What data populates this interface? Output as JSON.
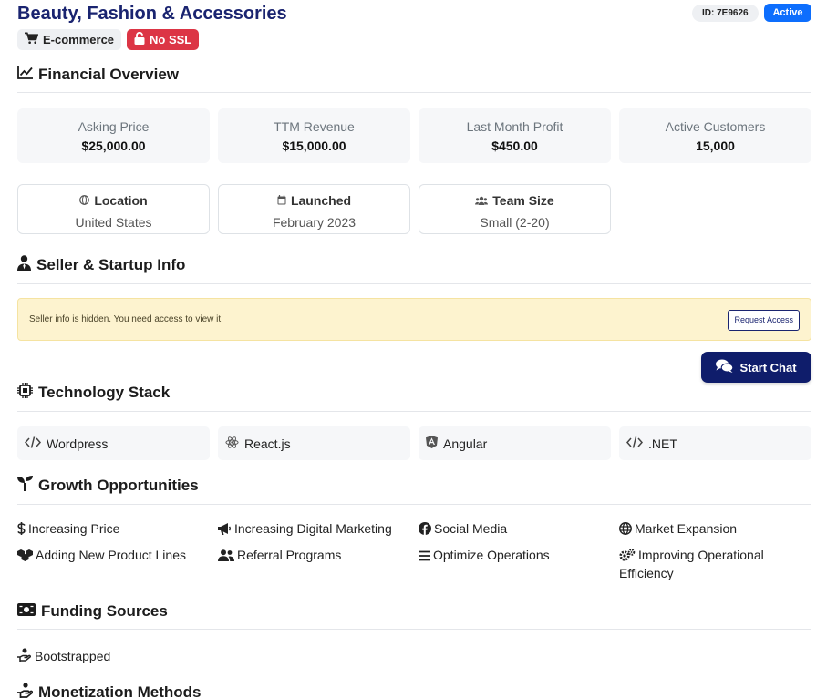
{
  "header": {
    "title": "Beauty, Fashion & Accessories",
    "id_label": "ID: 7E9626",
    "status": "Active",
    "tags": [
      {
        "label": "E-commerce",
        "icon": "cart-icon"
      },
      {
        "label": "No SSL",
        "icon": "unlock-icon",
        "color": "#dc3545"
      }
    ]
  },
  "financial": {
    "heading": "Financial Overview",
    "stats": [
      {
        "label": "Asking Price",
        "value": "$25,000.00"
      },
      {
        "label": "TTM Revenue",
        "value": "$15,000.00"
      },
      {
        "label": "Last Month Profit",
        "value": "$450.00"
      },
      {
        "label": "Active Customers",
        "value": "15,000"
      }
    ],
    "info": [
      {
        "label": "Location",
        "value": "United States",
        "icon": "globe-icon"
      },
      {
        "label": "Launched",
        "value": "February 2023",
        "icon": "calendar-icon"
      },
      {
        "label": "Team Size",
        "value": "Small (2-20)",
        "icon": "users-icon"
      }
    ]
  },
  "seller": {
    "heading": "Seller & Startup Info",
    "alert_text": "Seller info is hidden. You need access to view it.",
    "request_button": "Request Access",
    "chat_button": "Start Chat"
  },
  "tech": {
    "heading": "Technology Stack",
    "items": [
      {
        "label": "Wordpress",
        "icon": "code-icon"
      },
      {
        "label": "React.js",
        "icon": "react-icon"
      },
      {
        "label": "Angular",
        "icon": "angular-icon"
      },
      {
        "label": ".NET",
        "icon": "code-icon"
      }
    ]
  },
  "growth": {
    "heading": "Growth Opportunities",
    "items": [
      {
        "label": "Increasing Price",
        "icon": "dollar-icon"
      },
      {
        "label": "Increasing Digital Marketing",
        "icon": "megaphone-icon"
      },
      {
        "label": "Social Media",
        "icon": "facebook-icon"
      },
      {
        "label": "Market Expansion",
        "icon": "globe-icon"
      },
      {
        "label": "Adding New Product Lines",
        "icon": "boxes-icon"
      },
      {
        "label": "Referral Programs",
        "icon": "user-group-icon"
      },
      {
        "label": "Optimize Operations",
        "icon": "bars-icon"
      },
      {
        "label": "Improving Operational Efficiency",
        "icon": "gears-icon"
      }
    ]
  },
  "funding": {
    "heading": "Funding Sources",
    "items": [
      {
        "label": "Bootstrapped",
        "icon": "hand-coin-icon"
      }
    ]
  },
  "monetization": {
    "heading": "Monetization Methods"
  },
  "colors": {
    "title": "#1a2470",
    "active_badge": "#0d6efd",
    "danger": "#dc3545",
    "chat_button": "#0f1d6b",
    "alert_bg": "#fdf3cf"
  }
}
